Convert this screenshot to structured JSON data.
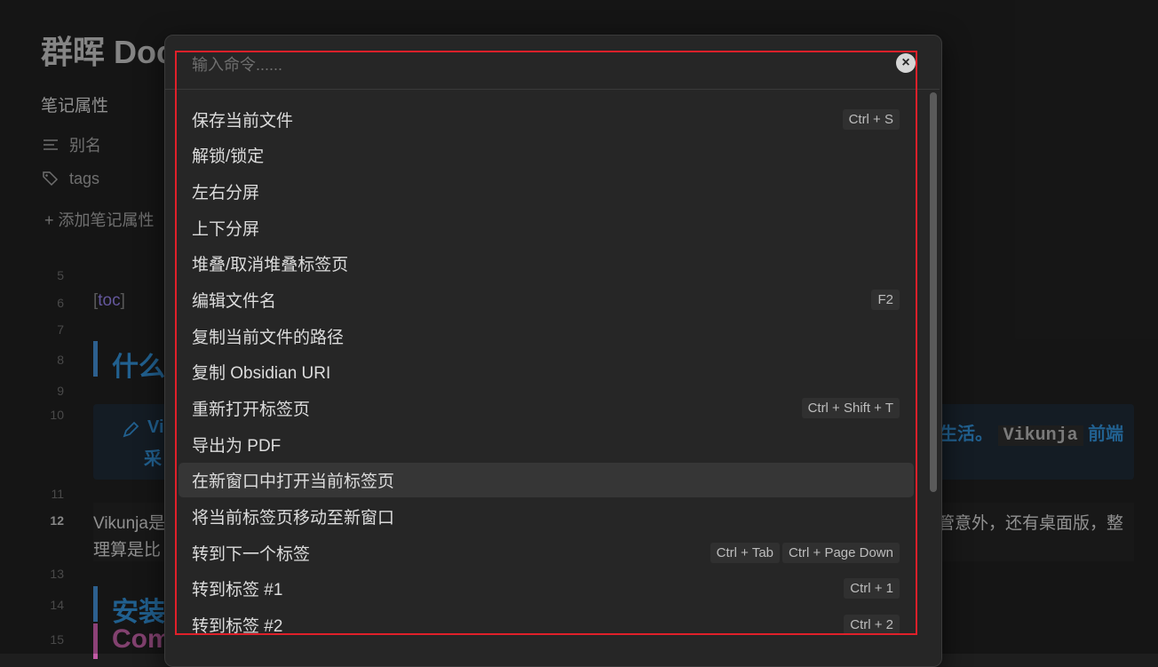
{
  "note": {
    "title": "群晖 Doc",
    "properties_heading": "笔记属性",
    "properties": [
      {
        "icon": "lines-icon",
        "label": "别名"
      },
      {
        "icon": "tags-icon",
        "label": "tags"
      }
    ],
    "add_property": "+ 添加笔记属性",
    "line_numbers": [
      "5",
      "6",
      "7",
      "8",
      "9",
      "10",
      "11",
      "12",
      "13",
      "14",
      "15"
    ],
    "current_line": "12",
    "toc_text": "toc",
    "heading1": "什么",
    "callout_left_1": "Vi",
    "callout_left_2": "采",
    "callout_right_text": "生活。",
    "callout_right_code": "Vikunja",
    "callout_right_tail": "前端",
    "para_line1": "Vikunja是",
    "para_line2": "理算是比",
    "para_right": "管意外，还有桌面版，整",
    "heading2": "安装",
    "heading3": "Com"
  },
  "palette": {
    "search_placeholder": "输入命令......",
    "search_value": "",
    "selected_index": 10,
    "commands": [
      {
        "label": "保存当前文件",
        "keys": [
          "Ctrl + S"
        ]
      },
      {
        "label": "解锁/锁定",
        "keys": []
      },
      {
        "label": "左右分屏",
        "keys": []
      },
      {
        "label": "上下分屏",
        "keys": []
      },
      {
        "label": "堆叠/取消堆叠标签页",
        "keys": []
      },
      {
        "label": "编辑文件名",
        "keys": [
          "F2"
        ]
      },
      {
        "label": "复制当前文件的路径",
        "keys": []
      },
      {
        "label": "复制 Obsidian URI",
        "keys": []
      },
      {
        "label": "重新打开标签页",
        "keys": [
          "Ctrl + Shift + T"
        ]
      },
      {
        "label": "导出为 PDF",
        "keys": []
      },
      {
        "label": "在新窗口中打开当前标签页",
        "keys": []
      },
      {
        "label": "将当前标签页移动至新窗口",
        "keys": []
      },
      {
        "label": "转到下一个标签",
        "keys": [
          "Ctrl + Tab",
          "Ctrl + Page Down"
        ]
      },
      {
        "label": "转到标签 #1",
        "keys": [
          "Ctrl + 1"
        ]
      },
      {
        "label": "转到标签 #2",
        "keys": [
          "Ctrl + 2"
        ]
      }
    ]
  },
  "colors": {
    "accent_blue": "#2f86c7",
    "highlight_frame": "#e0202a",
    "toc_purple": "#8b79d8"
  }
}
